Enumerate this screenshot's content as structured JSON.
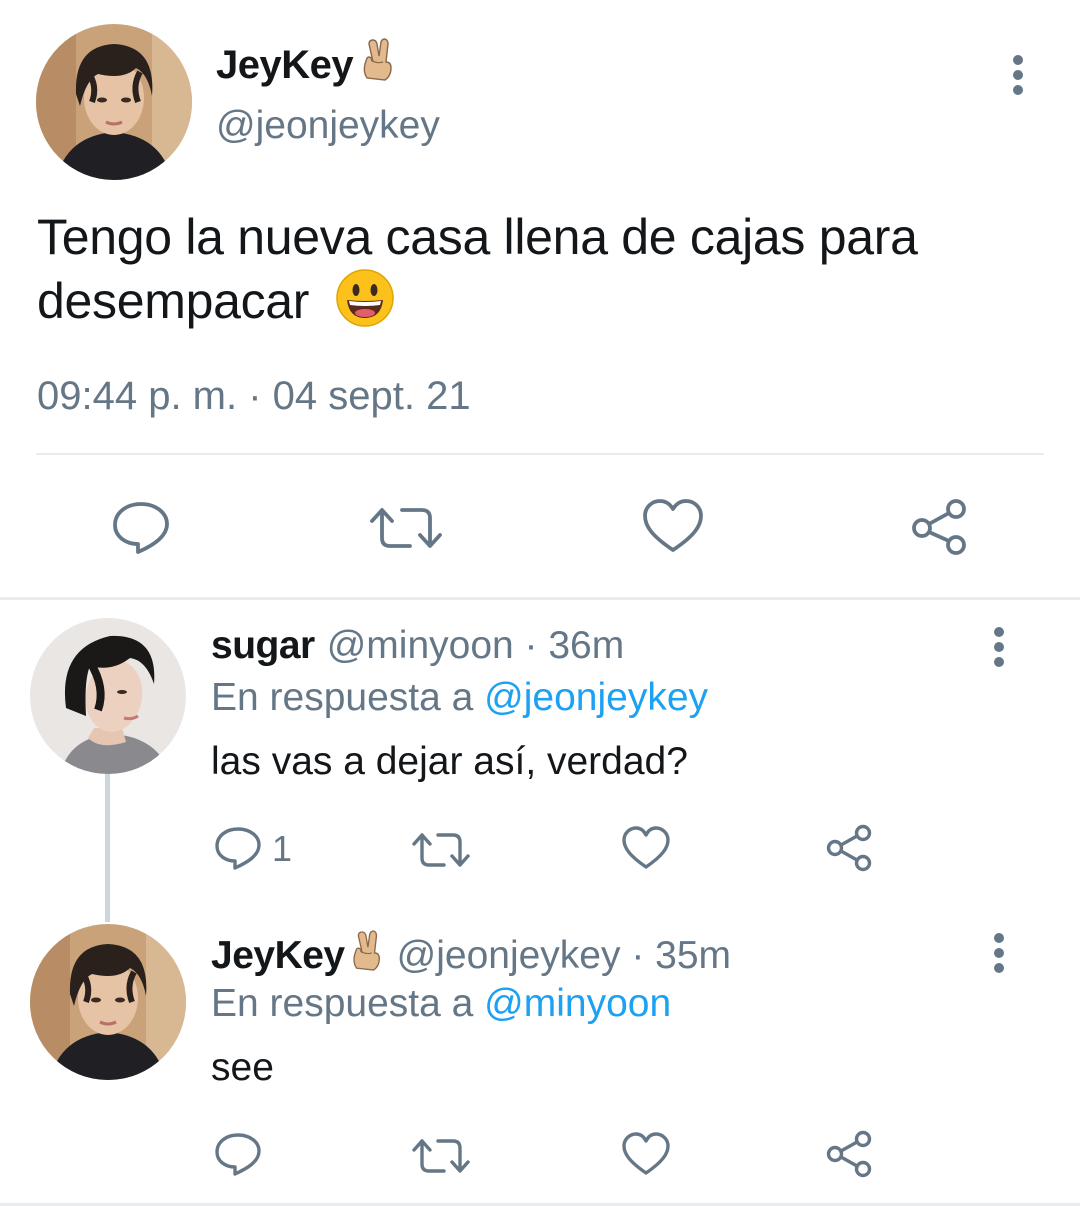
{
  "main_tweet": {
    "name": "JeyKey",
    "name_emoji": "victory-hand-emoji",
    "handle": "@jeonjeykey",
    "text": "Tengo la nueva casa llena de cajas para desempacar",
    "text_emoji": "grinning-face-emoji",
    "timestamp": "09:44 p. m. · 04 sept. 21",
    "actions": [
      "reply-icon",
      "retweet-icon",
      "like-icon",
      "share-icon"
    ]
  },
  "replies": [
    {
      "name": "sugar",
      "meta": "@minyoon · 36m",
      "reply_prefix": "En respuesta a ",
      "reply_to": "@jeonjeykey",
      "text": "las vas a dejar así, verdad?",
      "reply_count": "1"
    },
    {
      "name": "JeyKey",
      "name_emoji": "victory-hand-emoji",
      "meta": "@jeonjeykey · 35m",
      "reply_prefix": "En respuesta a ",
      "reply_to": "@minyoon",
      "text": "see",
      "reply_count": ""
    }
  ],
  "colors": {
    "text": "#14171a",
    "secondary": "#657786",
    "link": "#1da1f2",
    "divider": "#e6ecf0",
    "icon": "#657786"
  }
}
